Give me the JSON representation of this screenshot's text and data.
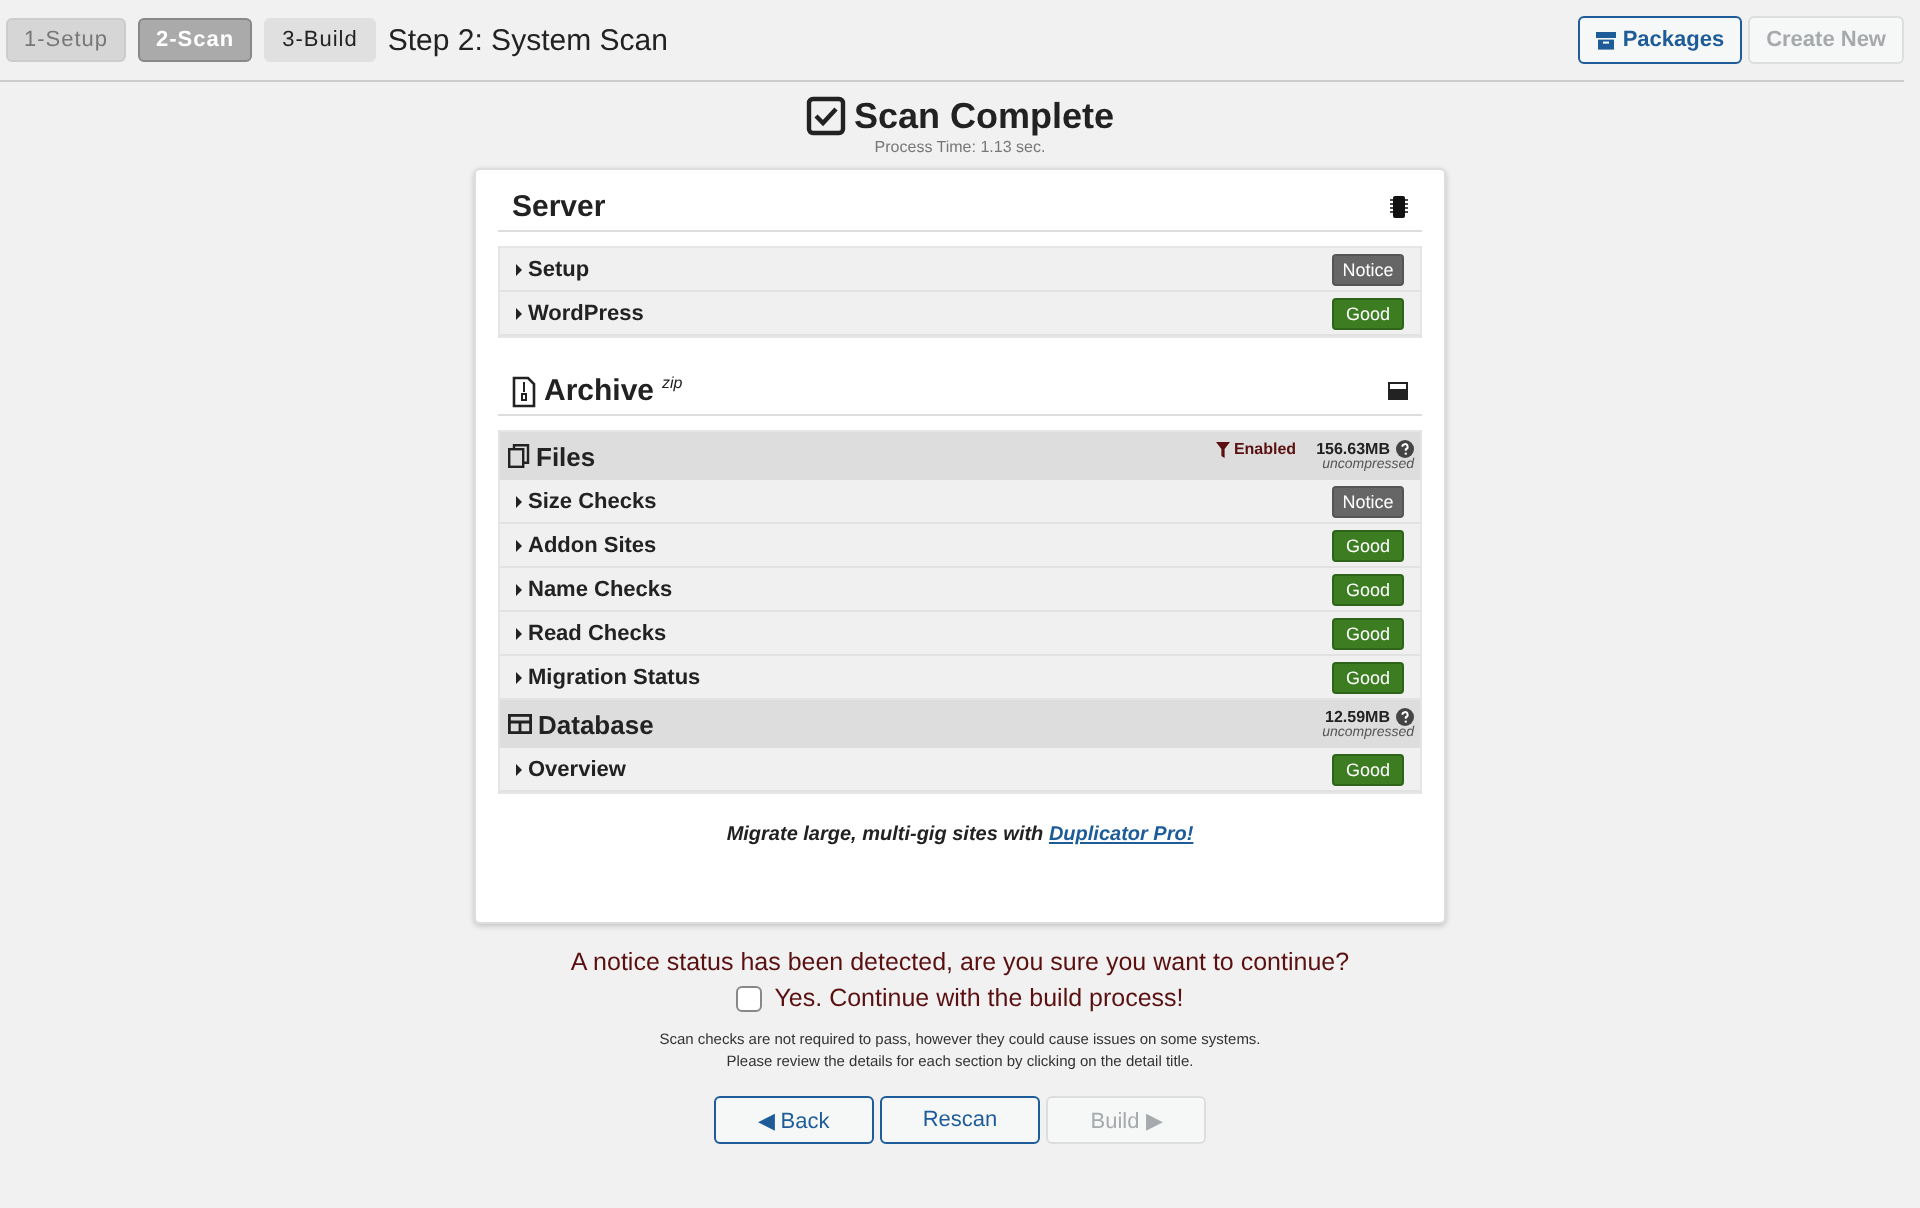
{
  "steps": [
    {
      "label": "1-Setup",
      "kind": "done"
    },
    {
      "label": "2-Scan",
      "kind": "active"
    },
    {
      "label": "3-Build",
      "kind": "todo"
    }
  ],
  "header_title": "Step 2: System Scan",
  "header_buttons": [
    {
      "label": "Packages",
      "disabled": false
    },
    {
      "label": "Create New",
      "disabled": true
    }
  ],
  "scan": {
    "title": "Scan Complete",
    "checked": true,
    "process_time": "Process Time: 1.13 sec."
  },
  "server": {
    "title": "Server",
    "rows": [
      {
        "label": "Setup",
        "status": "Notice",
        "kind": "notice"
      },
      {
        "label": "WordPress",
        "status": "Good",
        "kind": "good"
      }
    ]
  },
  "archive": {
    "title": "Archive",
    "suffix": "zip",
    "groups": [
      {
        "title": "Files",
        "kind": "files",
        "filter": "Enabled",
        "size": "156.63MB",
        "size_note": "uncompressed",
        "rows": [
          {
            "label": "Size Checks",
            "status": "Notice",
            "kind": "notice"
          },
          {
            "label": "Addon Sites",
            "status": "Good",
            "kind": "good"
          },
          {
            "label": "Name Checks",
            "status": "Good",
            "kind": "good"
          },
          {
            "label": "Read Checks",
            "status": "Good",
            "kind": "good"
          },
          {
            "label": "Migration Status",
            "status": "Good",
            "kind": "good"
          }
        ]
      },
      {
        "title": "Database",
        "kind": "table",
        "size": "12.59MB",
        "size_note": "uncompressed",
        "rows": [
          {
            "label": "Overview",
            "status": "Good",
            "kind": "good"
          }
        ]
      }
    ]
  },
  "promo": {
    "text": "Migrate large, multi-gig sites with",
    "link": "Duplicator Pro!"
  },
  "notice": "A notice status has been detected, are you sure you want to continue?",
  "confirm": {
    "label": "Yes. Continue with the build process!",
    "checked": false
  },
  "help": [
    "Scan checks are not required to pass, however they could cause issues on some systems.",
    "Please review the details for each section by clicking on the detail title."
  ],
  "buttons": [
    {
      "label": "◀ Back",
      "disabled": false
    },
    {
      "label": "Rescan",
      "disabled": false
    },
    {
      "label": "Build ▶",
      "disabled": true
    }
  ]
}
